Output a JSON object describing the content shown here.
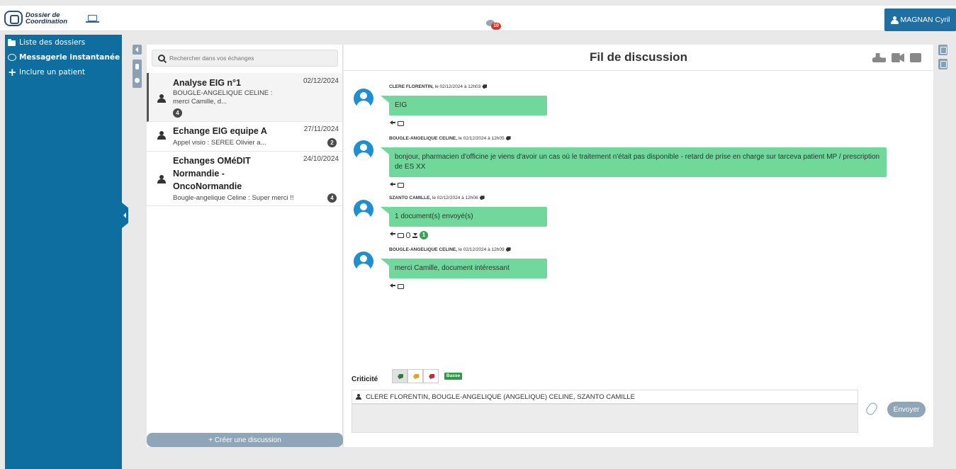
{
  "app": {
    "logo_text_line1": "Dossier de",
    "logo_text_line2": "Coordination",
    "notification_count": "10",
    "user_name": "MAGNAN Cyril"
  },
  "sidebar": {
    "items": [
      {
        "label": "Liste des dossiers",
        "icon": "folder-icon"
      },
      {
        "label": "Messagerie instantanée",
        "icon": "chat-icon"
      },
      {
        "label": "Inclure un patient",
        "icon": "plus-icon"
      }
    ]
  },
  "conversations": {
    "search_placeholder": "Rechercher dans vos échanges",
    "items": [
      {
        "title": "Analyse EIG n°1",
        "date": "02/12/2024",
        "preview_line1": "BOUGLE-ANGELIQUE CELINE :",
        "preview_line2": "merci Camille, d...",
        "count": "4"
      },
      {
        "title": "Echange EIG equipe A",
        "date": "27/11/2024",
        "preview_line1": "Appel visio :  SEREE Olivier a...",
        "count": "2"
      },
      {
        "title_line1": "Echanges OMéDIT",
        "title_line2": "Normandie -",
        "title_line3": "OncoNormandie",
        "date": "24/10/2024",
        "preview_line1": "Bougle-angelique Celine :  Super merci !!",
        "count": "4"
      }
    ],
    "create_label": "+ Créer une discussion"
  },
  "discussion": {
    "title": "Fil de discussion",
    "messages": [
      {
        "author": "CLERE FLORENTIN,",
        "meta": " le 02/12/2024 à 12h03",
        "text": "EIG"
      },
      {
        "author": "BOUGLE-ANGELIQUE CELINE,",
        "meta": " le 02/12/2024 à 12h05",
        "text": "bonjour, pharmacien d'officine je viens d'avoir un cas où le traitement n'était pas disponible - retard de prise en charge sur tarceva patient MP / prescription de ES XX"
      },
      {
        "author": "SZANTO CAMILLE,",
        "meta": " le 02/12/2024 à 12h06",
        "text": "1 document(s) envoyé(s)",
        "doc_count": "1"
      },
      {
        "author": "BOUGLE-ANGELIQUE CELINE,",
        "meta": " le 02/12/2024 à 12h09",
        "text": "merci Camille, document intéressant"
      }
    ],
    "criticite_label": "Criticité",
    "criticite_colors": [
      "#2f7a3a",
      "#e7a020",
      "#b9313a"
    ],
    "criticite_level": "Basse",
    "recipients": "CLERE FLORENTIN, BOUGLE-ANGELIQUE (ANGELIQUE) CELINE, SZANTO CAMILLE",
    "message_value": "",
    "send_label": "Envoyer"
  }
}
